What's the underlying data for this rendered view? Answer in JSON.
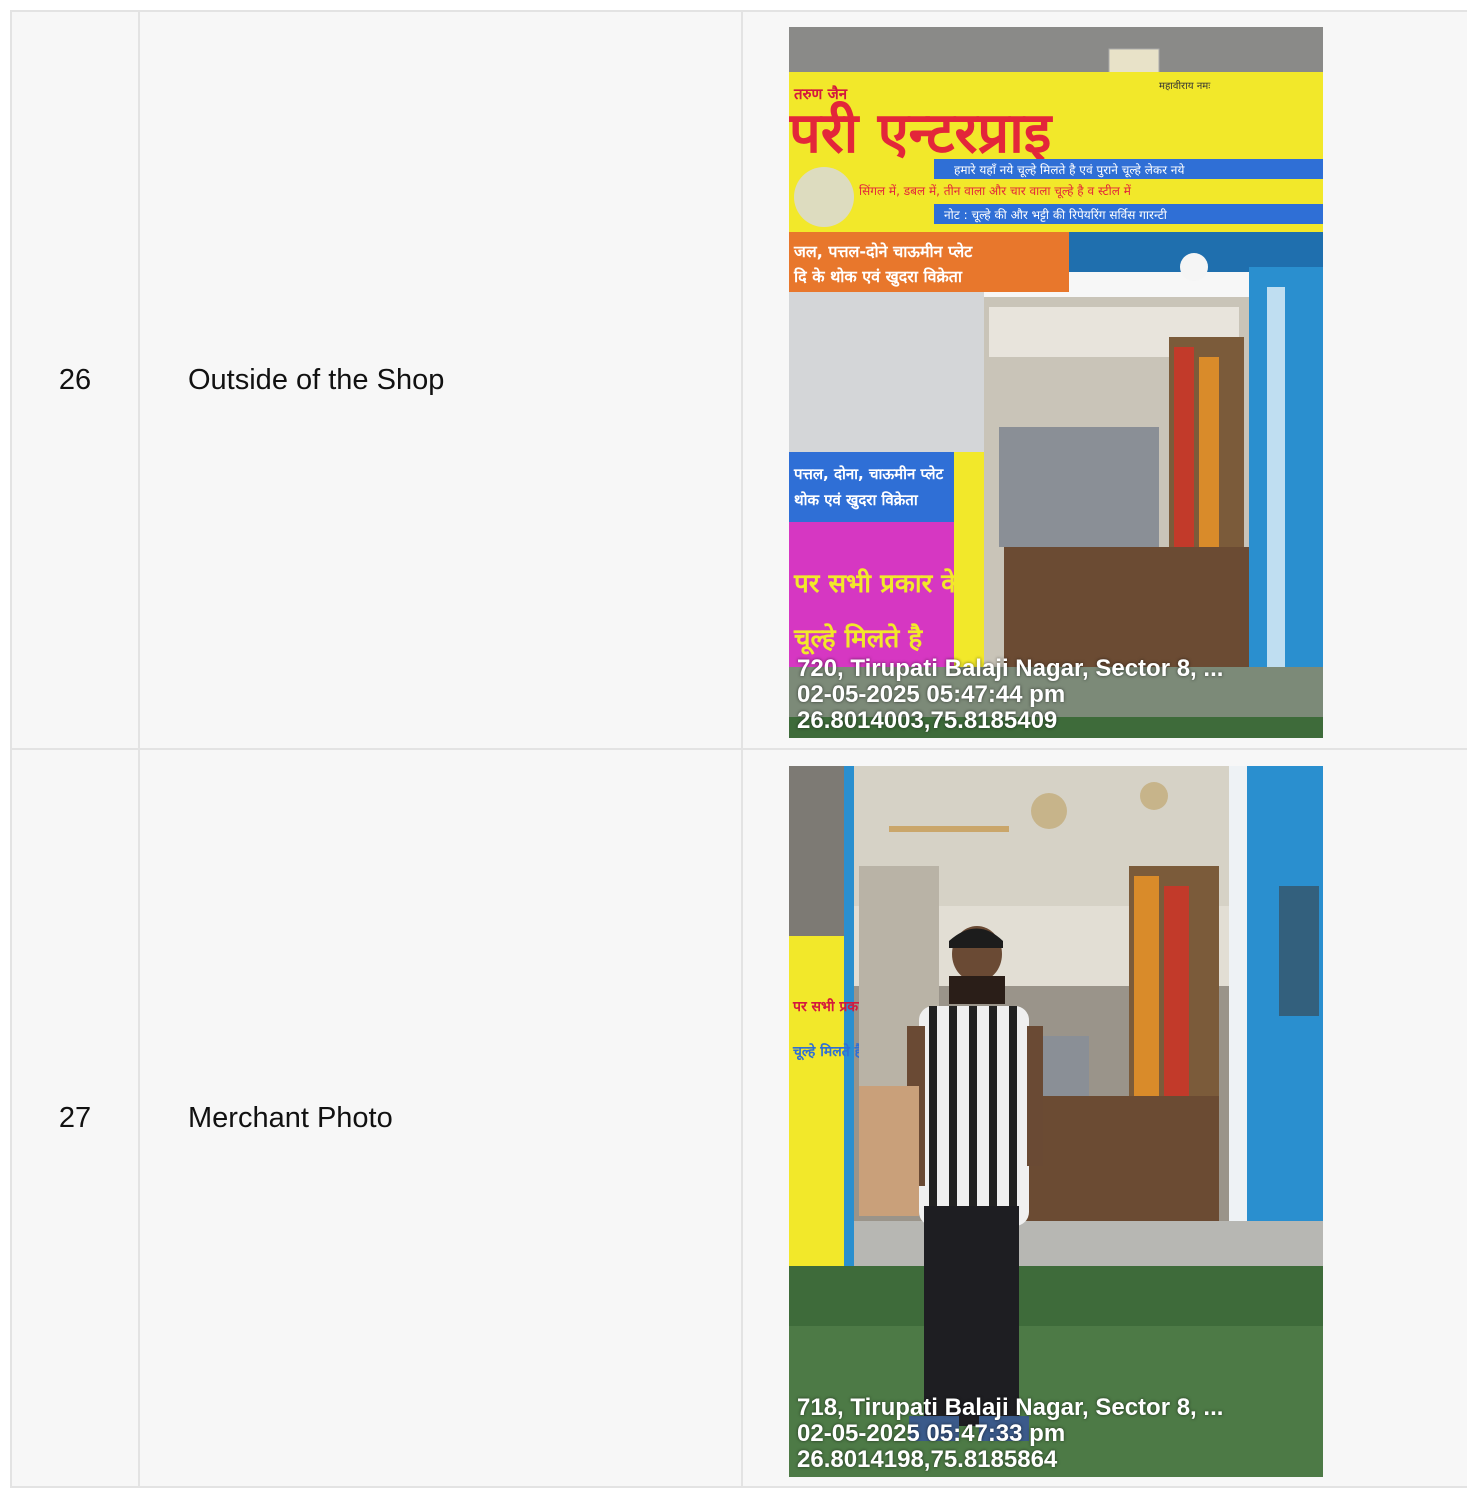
{
  "rows": [
    {
      "number": "26",
      "label": "Outside of the Shop",
      "photo": {
        "subject": "shop-front",
        "address": "720, Tirupati Balaji Nagar, Sector 8, ...",
        "datetime": "02-05-2025 05:47:44 pm",
        "coords": "26.8014003,75.8185409",
        "sign_lines": [
          "तरुण जैन",
          "महावीराय नमः",
          "परी एन्टरप्राइ",
          "हमारे यहाँ नये चूल्हे मिलते है एवं पुराने चूल्हे लेकर नये",
          "सिंगल में, डबल में, तीन वाला और चार वाला चूल्हे है व स्टील में",
          "नोट : चूल्हे की और भट्टी की रिपेयरिंग सर्विस गारन्टी",
          "जल, पत्तल-दोने चाऊमीन प्लेट",
          "दि के थोक एवं खुदरा विक्रेता",
          "पत्तल, दोना, चाऊमीन प्लेट",
          "थोक एवं खुदरा विक्रेता",
          "पर सभी प्रकार के",
          "चूल्हे मिलते है"
        ]
      }
    },
    {
      "number": "27",
      "label": "Merchant Photo",
      "photo": {
        "subject": "merchant-standing",
        "address": "718, Tirupati Balaji Nagar, Sector 8, ...",
        "datetime": "02-05-2025 05:47:33 pm",
        "coords": "26.8014198,75.8185864",
        "sign_lines": [
          "पर सभी प्रकार",
          "चूल्हे मिलते है"
        ]
      }
    }
  ],
  "colors": {
    "border": "#e3e3e3",
    "cell_bg": "#f7f7f7",
    "sign_yellow": "#f2e82a",
    "sign_blue": "#2f6fd6",
    "shop_blue": "#2a8fcf",
    "grass": "#3e6b3a"
  }
}
